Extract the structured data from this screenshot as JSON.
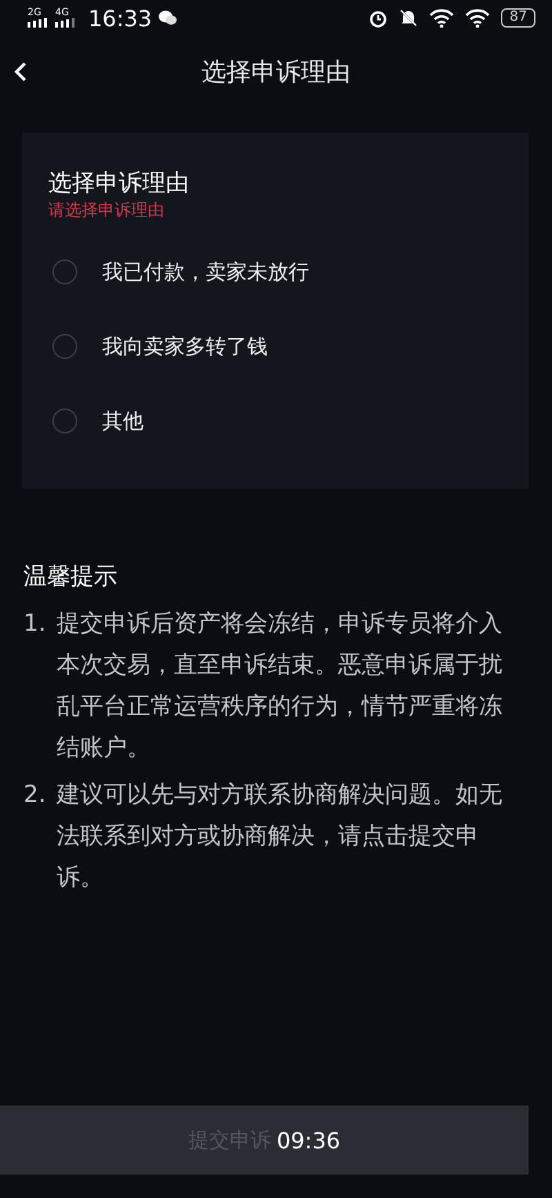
{
  "status_bar": {
    "network_1": "2G",
    "network_2": "4G",
    "time": "16:33",
    "battery": "87"
  },
  "header": {
    "title": "选择申诉理由"
  },
  "reason_card": {
    "title": "选择申诉理由",
    "error": "请选择申诉理由",
    "options": [
      {
        "label": "我已付款，卖家未放行",
        "selected": false
      },
      {
        "label": "我向卖家多转了钱",
        "selected": false
      },
      {
        "label": "其他",
        "selected": false
      }
    ]
  },
  "tips": {
    "title": "温馨提示",
    "items": [
      {
        "number": "1.",
        "text": "提交申诉后资产将会冻结，申诉专员将介入本次交易，直至申诉结束。恶意申诉属于扰乱平台正常运营秩序的行为，情节严重将冻结账户。"
      },
      {
        "number": "2.",
        "text": "建议可以先与对方联系协商解决问题。如无法联系到对方或协商解决，请点击提交申诉。"
      }
    ]
  },
  "submit": {
    "label": "提交申诉",
    "timer": "09:36",
    "disabled": true
  }
}
